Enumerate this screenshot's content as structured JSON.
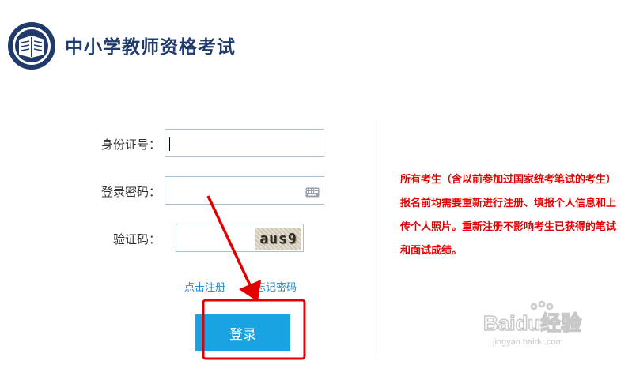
{
  "header": {
    "title": "中小学教师资格考试",
    "logo_icon": "exam-seal-logo-icon"
  },
  "form": {
    "id_label": "身份证号：",
    "id_value": "",
    "password_label": "登录密码：",
    "password_value": "",
    "captcha_label": "验证码：",
    "captcha_value": "",
    "captcha_image_text": "aus9",
    "keyboard_icon": "keyboard-icon"
  },
  "links": {
    "register": "点击注册",
    "forgot_password": "忘记密码"
  },
  "buttons": {
    "login": "登录"
  },
  "notice": {
    "text": "所有考生（含以前参加过国家统考笔试的考生）报名前均需要重新进行注册、填报个人信息和上传个人照片。重新注册不影响考生已获得的笔试和面试成绩。"
  },
  "watermark": {
    "brand": "Baidu经验",
    "url": "jingyan.baidu.com"
  },
  "colors": {
    "title": "#1f3a6b",
    "link": "#2a8bd0",
    "button": "#1aa3e2",
    "notice": "#e60000",
    "annotation": "#e00000"
  }
}
